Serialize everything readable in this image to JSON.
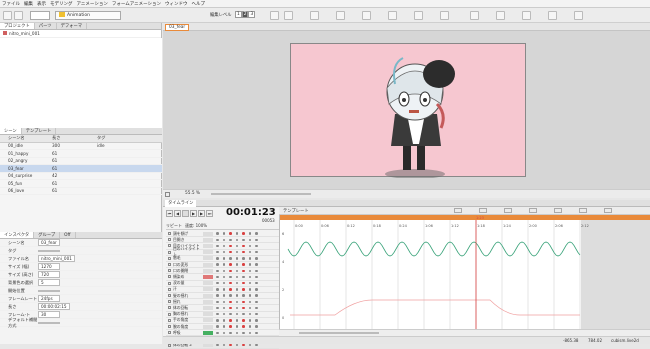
{
  "menu": [
    "ファイル",
    "編集",
    "表示",
    "モデリング",
    "アニメーション",
    "フォームアニメーション",
    "ウィンドウ",
    "ヘルプ"
  ],
  "toolbar": {
    "mode": "Animation",
    "edit_level_label": "編集レベル",
    "level_1": "1",
    "level_2": "2",
    "level_3": "3"
  },
  "project": {
    "tabs": [
      "プロジェクト",
      "パーツ",
      "デフォーマ"
    ],
    "item": "nitro_mini_001"
  },
  "scene": {
    "tabs": [
      "シーン",
      "テンプレート"
    ],
    "headers": [
      "シーン名",
      "長さ",
      "タグ"
    ],
    "rows": [
      [
        "00_idle",
        "300",
        "idle"
      ],
      [
        "01_happy",
        "61",
        ""
      ],
      [
        "02_angry",
        "61",
        ""
      ],
      [
        "03_fear",
        "61",
        ""
      ],
      [
        "04_surprise",
        "42",
        ""
      ],
      [
        "05_fun",
        "61",
        ""
      ],
      [
        "06_love",
        "61",
        ""
      ]
    ]
  },
  "inspector": {
    "tabs": [
      "インスペクタ",
      "グループ",
      "Off"
    ],
    "fields": [
      [
        "シーン名",
        "03_fear"
      ],
      [
        "タグ",
        ""
      ],
      [
        "ファイル名",
        "nitro_mini_001"
      ],
      [
        "サイズ (幅)",
        "1270"
      ],
      [
        "サイズ (高さ)",
        "720"
      ],
      [
        "背景色の選択",
        "5"
      ],
      [
        "開始位置",
        ""
      ],
      [
        "フレームレート",
        "24fps"
      ],
      [
        "長さ",
        "00:00:02:15"
      ],
      [
        "フレーム-ト",
        "30"
      ],
      [
        "デフォルト補間方式",
        ""
      ]
    ]
  },
  "stage": {
    "tab": "03_fear",
    "zoom": "55.5 %"
  },
  "timeline": {
    "tab": "タイムライン",
    "time": "00:01:23",
    "frame": "00053",
    "repeat": "リピート",
    "speed": "速度: 100%",
    "template": "テンプレート",
    "params": [
      "頭を傾げ",
      "目開き",
      "目のハイライト",
      "目のハイライト 上",
      "眉毛",
      "口の変形",
      "口の開閉",
      "頬染め",
      "涙の量",
      "汗",
      "髪の揺れ",
      "揺れ",
      "体の回転",
      "胸の揺れ",
      "手の角度",
      "腕の角度",
      "呼吸",
      "体の回転 Y",
      "体の回転 Z"
    ]
  },
  "graph": {
    "ticks": [
      "0:00",
      "0:06",
      "0:12",
      "0:18",
      "0:24",
      "1:06",
      "1:12",
      "1:18",
      "1:24",
      "2:00",
      "2:06",
      "2:12"
    ],
    "marker": "1:23",
    "yticks": [
      "6",
      "4",
      "2",
      "0"
    ]
  },
  "status": {
    "coords": "-865.38",
    "coords2": "784.02",
    "right": "cubism.live2d"
  },
  "colors": {
    "accent": "#e98a3a",
    "canvas": "#f6c7d0",
    "wave": "#3aa37a",
    "cursor": "#d94040",
    "selected": "#c8d8ee"
  }
}
